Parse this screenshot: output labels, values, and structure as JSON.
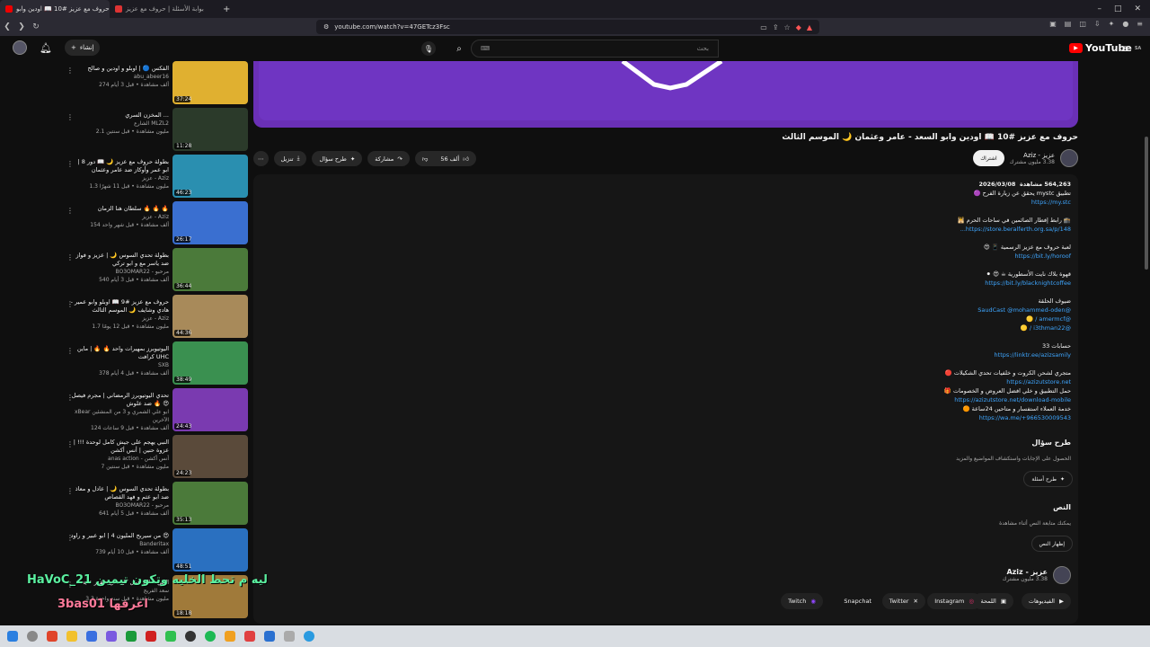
{
  "browser": {
    "tabs": [
      {
        "label": "حروف مع عزيز #10 📖 اودين وابو",
        "active": true
      },
      {
        "label": "بوابة الأسئلة | حروف مع عزيز",
        "active": false
      }
    ],
    "url": "youtube.com/watch?v=47GETcz3Fsc"
  },
  "header": {
    "create_label": "إنشاء",
    "search_placeholder": "بحث",
    "logo_text": "YouTube",
    "logo_region": "SA"
  },
  "video": {
    "title": "حروف مع عزيز #10 📖 اودين وابو السعد - عامر وعثمان 🌙 الموسم الثالث",
    "channel": "عزيز - Aziz",
    "subscribers": "3.38 مليون مشترك",
    "subscribe_label": "اشتراك",
    "likes": "56 ألف",
    "share_label": "مشاركة",
    "ask_label": "طرح سؤال",
    "download_label": "تنزيل"
  },
  "description": {
    "views": "564,263 مشاهدة",
    "date": "2026/03/08",
    "lines": [
      {
        "text": "تطبيق mystc يحقق عن زيارة الفرح 🟣",
        "link": "https://my.stc"
      },
      {
        "text": "🕋 رابط إفطار الصائمين في ساحات الحرم 🕌",
        "link": "https://store.beralferth.org.sa/p/148..."
      },
      {
        "text": "لعبة حروف مع عزيز الرسمية 📱 😍",
        "link": "https://bit.ly/horoof"
      },
      {
        "text": "قهوة بلاك نايت الأسطورية ☕ 😍 ⚫",
        "link": "https://bit.ly/blacknightcoffee"
      },
      {
        "text": "ضيوف الحلقة",
        "link": "@SaudCast @mohammed-oden"
      },
      {
        "text": "",
        "link": "@amermcf / 🟡"
      },
      {
        "text": "",
        "link": "@i3thman22 / 🟡"
      },
      {
        "text": "حسابات 33",
        "link": "https://linktr.ee/azizsamily"
      },
      {
        "text": "متجري لشحن الكروت و خلفيات تحدي الشكيلات 🔴",
        "link": "https://azizutstore.net"
      },
      {
        "text": "حمل التطبيق و خلي افضل العروض و الخصومات 🎁",
        "link": "https://azizutstore.net/download-mobile"
      },
      {
        "text": "خدمة العملاء استفسار و متاحين 24ساعة 🟠",
        "link": "https://wa.me/+966530009543"
      }
    ]
  },
  "ask": {
    "heading": "طرح سؤال",
    "sub": "الحصول على الإجابات واستكشاف المواضيع والمزيد",
    "button": "طرح أسئلة"
  },
  "transcript": {
    "heading": "النص",
    "sub": "يمكنك متابعة النص أثناء مشاهدة",
    "button": "إظهار النص"
  },
  "footer_channel": {
    "name": "عزيز - Aziz",
    "subs": "3.38 مليون مشترك",
    "links": [
      "الفيديوهات",
      "اللمحة",
      "Instagram",
      "Twitter",
      "Snapchat",
      "Twitch"
    ]
  },
  "sidebar": {
    "items": [
      {
        "title": "الفكس 🔵 | اوبلو و اودين و صالح",
        "channel": "abu_abeer16",
        "meta": "274 ألف مشاهدة • قبل 3 أيام",
        "dur": "37:24",
        "color": "#e0b030"
      },
      {
        "title": "المخزن السري ...",
        "channel": "الشارع MLZL2",
        "meta": "2.1 مليون مشاهدة • قبل سنتين",
        "dur": "11:28",
        "color": "#2b3a2a"
      },
      {
        "title": "بطولة حروف مع عزيز 🌙 📖 دور 8 | ابو عمر وأوكاز ضد عامر وعثمان",
        "channel": "عزيز - Aziz",
        "meta": "1.3 مليون مشاهدة • قبل 11 شهرًا",
        "dur": "46:23",
        "color": "#2a8fb0"
      },
      {
        "title": "سلطان هنا الزمان 🔥 🔥 🔥",
        "channel": "عزيز - Aziz",
        "meta": "154 ألف مشاهدة • قبل شهر واحد",
        "dur": "26:17",
        "color": "#3a6fd0"
      },
      {
        "title": "بطولة تحدي السوس 🌙 | عزيز و فواز ضد ياسر مع و ابو تركي",
        "channel": "BO3OMAR22 - مرحبو",
        "meta": "540 ألف مشاهدة • قبل 3 أيام",
        "dur": "36:44",
        "color": "#4b7a3a"
      },
      {
        "title": "حروف مع عزيز #9 📖 اوبلو وابو عمير - هادي وشايف 🌙 الموسم الثالث",
        "channel": "عزيز - Aziz",
        "meta": "1.7 مليون مشاهدة • قبل 12 يومًا",
        "dur": "44:36",
        "color": "#a88a5a"
      },
      {
        "title": "اليوتيوبرز بمهيرات واحد 🔥 🔥 | ماين كرافت UHC",
        "channel": "SXB",
        "meta": "378 ألف مشاهدة • قبل 4 أيام",
        "dur": "38:49",
        "color": "#3a9050"
      },
      {
        "title": "تحدي اليوتيوبرز الرمضاني | مجرم فيصل ضد علوش 🔥 😍",
        "channel": "xBear ابو علي الشمري و 3 من المنشئين الآخرين",
        "meta": "124 ألف مشاهدة • قبل 9 ساعات",
        "dur": "24:43",
        "color": "#7a3ab0"
      },
      {
        "title": "النبي يهجم على جيش كامل لوحدة !!! | عزوة حنين | أنس أكشن",
        "channel": "anas action - أنس أكشن",
        "meta": "7 مليون مشاهدة • قبل سنتين",
        "dur": "24:23",
        "color": "#5a4a3a"
      },
      {
        "title": "بطولة تحدي السوس 🌙 | عادل و معاذ ضد ابو عثم و فهد القصاص",
        "channel": "BO3OMAR22 - مرحبو",
        "meta": "641 ألف مشاهدة • قبل 5 أيام",
        "dur": "35:13",
        "color": "#4b7a3a"
      },
      {
        "title": "من سيربح المليون 4 | ابو عبير و راود 😍",
        "channel": "Banderitax",
        "meta": "739 ألف مشاهدة • قبل 10 أيام",
        "dur": "48:51",
        "color": "#2a70c0"
      },
      {
        "title": "النبي صالح عمل كل شيء يقدر عليه",
        "channel": "سعد الفريج",
        "meta": "3.3 مليون مشاهدة • قبل سنة واحدة",
        "dur": "18:18",
        "color": "#a07a3a"
      }
    ]
  },
  "overlay": {
    "line1": "HaVoC_21 ليه م تحط الخليه وتكون تيمين",
    "line2": "3bas01 اعرفها"
  },
  "colors": {
    "accent": "#3ea6ff",
    "player": "#6a30b6",
    "brand": "#ff0000"
  }
}
